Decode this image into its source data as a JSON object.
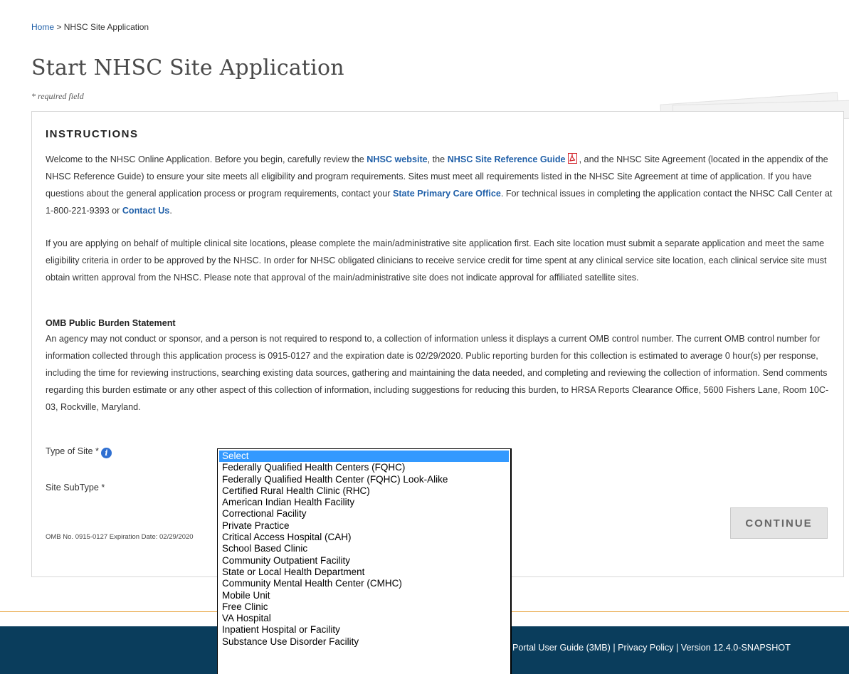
{
  "breadcrumb": {
    "home": "Home",
    "separator": " > ",
    "current": "NHSC Site Application"
  },
  "page": {
    "title": "Start NHSC Site Application",
    "required_note": "* required field"
  },
  "instructions": {
    "heading": "INSTRUCTIONS",
    "p1_a": "Welcome to the NHSC Online Application. Before you begin, carefully review the ",
    "p1_link_website": "NHSC website",
    "p1_b": ", the ",
    "p1_link_guide": "NHSC Site Reference Guide",
    "p1_c": ", and the NHSC Site Agreement (located in the appendix of the NHSC Reference Guide) to ensure your site meets all eligibility and program requirements. Sites must meet all requirements listed in the NHSC Site Agreement at time of application. If you have questions about the general application process or program requirements, contact your ",
    "p1_link_pco": "State Primary Care Office",
    "p1_d": ". For technical issues in completing the application contact the NHSC Call Center at 1-800-221-9393 or ",
    "p1_link_contact": "Contact Us",
    "p1_e": ".",
    "p2": "If you are applying on behalf of multiple clinical site locations, please complete the main/administrative site application first. Each site location must submit a separate application and meet the same eligibility criteria in order to be approved by the NHSC. In order for NHSC obligated clinicians to receive service credit for time spent at any clinical service site location, each clinical service site must obtain written approval from the NHSC. Please note that approval of the main/administrative site does not indicate approval for affiliated satellite sites."
  },
  "omb": {
    "heading": "OMB Public Burden Statement",
    "text": "An agency may not conduct or sponsor, and a person is not required to respond to, a collection of information unless it displays a current OMB control number. The current OMB control number for information collected through this application process is 0915-0127 and the expiration date is 02/29/2020. Public reporting burden for this collection is estimated to average 0 hour(s) per response, including the time for reviewing instructions, searching existing data sources, gathering and maintaining the data needed, and completing and reviewing the collection of information. Send comments regarding this burden estimate or any other aspect of this collection of information, including suggestions for reducing this burden, to HRSA Reports Clearance Office, 5600 Fishers Lane, Room 10C-03, Rockville, Maryland.",
    "footer_note": "OMB No. 0915-0127 Expiration Date: 02/29/2020"
  },
  "form": {
    "type_label": "Type of Site *",
    "subtype_label": "Site SubType *",
    "continue_label": "CONTINUE"
  },
  "dropdown": {
    "options": [
      "Select",
      "Federally Qualified Health Centers (FQHC)",
      "Federally Qualified Health Center (FQHC) Look-Alike",
      "Certified Rural Health Clinic (RHC)",
      "American Indian Health Facility",
      "Correctional Facility",
      "Private Practice",
      "Critical Access Hospital (CAH)",
      "School Based Clinic",
      "Community Outpatient Facility",
      "State or Local Health Department",
      "Community Mental Health Center (CMHC)",
      "Mobile Unit",
      "Free Clinic",
      "VA Hospital",
      "Inpatient Hospital or Facility",
      "Substance Use Disorder Facility"
    ],
    "selected_index": 0
  },
  "footer": {
    "links_text": "Portal User Guide (3MB) | Privacy Policy | Version 12.4.0-SNAPSHOT"
  },
  "colors": {
    "link": "#1f5fa8",
    "footer_bg": "#0a3d5c",
    "divider": "#e8a33d",
    "selected_option": "#3399ff",
    "info_icon": "#2f6fd1",
    "pdf_icon": "#d2232a"
  }
}
